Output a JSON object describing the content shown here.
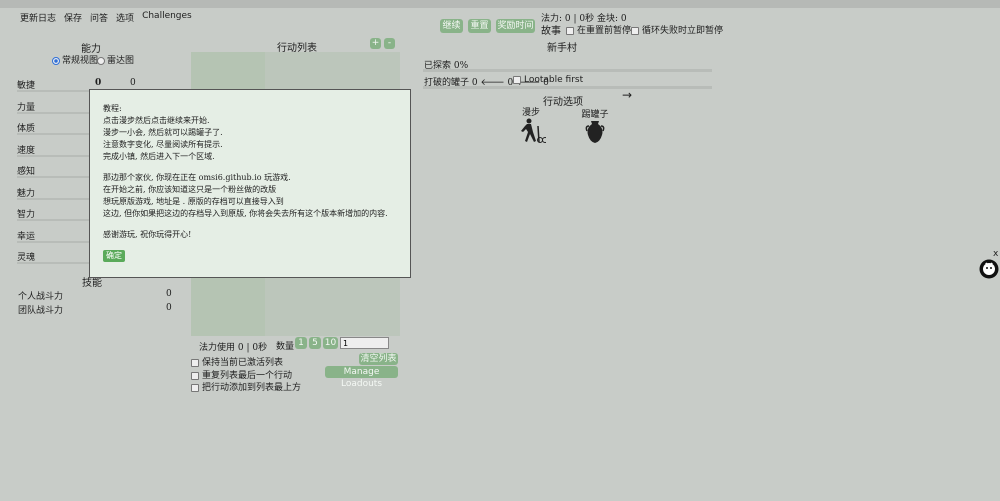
{
  "menu": [
    "更新日志",
    "保存",
    "问答",
    "选项",
    "Challenges"
  ],
  "header": {
    "buttons": [
      "继续",
      "重置",
      "奖励时间"
    ],
    "status": "法力: 0 | 0秒  金块: 0",
    "story_label": "故事",
    "pause_on_reset": "在重置前暂停",
    "pause_on_fail": "循环失败时立即暂停"
  },
  "stats": {
    "title": "能力",
    "view_normal": "常规视图",
    "view_radar": "雷达图",
    "items": [
      {
        "name": "敏捷",
        "level": "0",
        "value": "0"
      },
      {
        "name": "力量",
        "level": "",
        "value": ""
      },
      {
        "name": "体质",
        "level": "",
        "value": ""
      },
      {
        "name": "速度",
        "level": "",
        "value": ""
      },
      {
        "name": "感知",
        "level": "",
        "value": ""
      },
      {
        "name": "魅力",
        "level": "",
        "value": ""
      },
      {
        "name": "智力",
        "level": "",
        "value": ""
      },
      {
        "name": "幸运",
        "level": "",
        "value": ""
      },
      {
        "name": "灵魂",
        "level": "",
        "value": ""
      }
    ],
    "skills_title": "技能",
    "skills": [
      {
        "name": "个人战斗力",
        "value": "0"
      },
      {
        "name": "团队战斗力",
        "value": "0"
      }
    ]
  },
  "actions": {
    "title": "行动列表",
    "plus": "+",
    "minus": "-",
    "mana_used": "法力使用 0 | 0秒",
    "amount_label": "数量",
    "amounts": [
      "1",
      "5",
      "10"
    ],
    "amount_value": "1",
    "keep_active": "保持当前已激活列表",
    "repeat_last": "重复列表最后一个行动",
    "add_top": "把行动添加到列表最上方",
    "clear_list": "清空列表",
    "manage_loadouts": "Manage Loadouts"
  },
  "town": {
    "title": "新手村",
    "explored": "已探索 0%",
    "pots": "打破的罐子 0",
    "pots_left": "0",
    "pots_right": "0",
    "lootable": "Lootable first",
    "options_title": "行动选项",
    "next_arrow": "→",
    "options": [
      {
        "label": "漫步",
        "icon": "hiker-icon"
      },
      {
        "label": "踢罐子",
        "icon": "vase-icon"
      }
    ]
  },
  "modal": {
    "lines1": [
      "教程:",
      "点击漫步然后点击继续来开始.",
      "漫步一小会, 然后就可以踢罐子了.",
      "注意数字变化, 尽量阅读所有提示.",
      "完成小镇, 然后进入下一个区域."
    ],
    "lines2": [
      "那边那个家伙, 你现在正在 omsi6.github.io 玩游戏.",
      "在开始之前, 你应该知道这只是一个粉丝做的改版",
      "想玩原版游戏, 地址是 . 原版的存档可以直接导入到",
      "这边, 但你如果把这边的存档导入到原版, 你将会失去所有这个版本新增加的内容."
    ],
    "lines3": [
      "感谢游玩, 祝你玩得开心!"
    ],
    "ok": "确定"
  },
  "side": {
    "close": "x"
  }
}
